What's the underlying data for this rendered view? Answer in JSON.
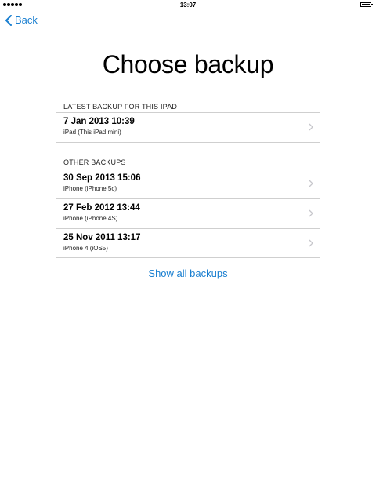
{
  "status_bar": {
    "time": "13:07"
  },
  "nav": {
    "back_label": "Back"
  },
  "page": {
    "title": "Choose backup"
  },
  "latest_section": {
    "header": "LATEST BACKUP FOR THIS IPAD",
    "items": [
      {
        "title": "7 Jan 2013 10:39",
        "subtitle": "iPad (This iPad mini)"
      }
    ]
  },
  "other_section": {
    "header": "OTHER BACKUPS",
    "items": [
      {
        "title": "30 Sep 2013 15:06",
        "subtitle": "iPhone (iPhone 5c)"
      },
      {
        "title": "27 Feb 2012 13:44",
        "subtitle": "iPhone (iPhone 4S)"
      },
      {
        "title": "25 Nov 2011 13:17",
        "subtitle": "iPhone 4 (iOS5)"
      }
    ]
  },
  "show_all_label": "Show all backups",
  "colors": {
    "accent": "#1a7fd0",
    "divider": "#cfcfcf",
    "chevron": "#c7c7cc"
  },
  "icons": {
    "back": "chevron-left-icon",
    "row": "chevron-right-icon",
    "signal": "signal-dots-icon",
    "battery": "battery-icon"
  }
}
